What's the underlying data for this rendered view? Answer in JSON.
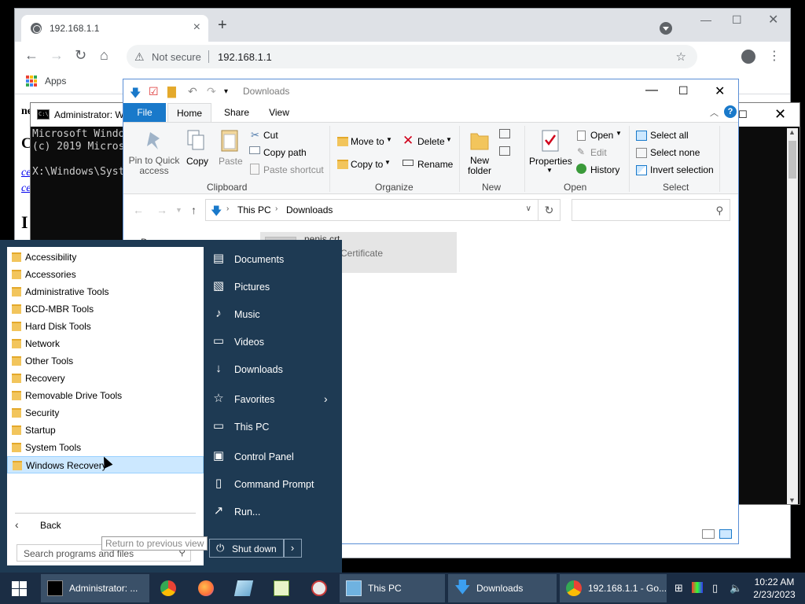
{
  "browser": {
    "tab_title": "192.168.1.1",
    "security_label": "Not secure",
    "url": "192.168.1.1",
    "bookmarks": {
      "apps_label": "Apps"
    },
    "page": {
      "line1": "ne",
      "line2": "C",
      "link1": "ce",
      "link2": "ce",
      "line5": "I"
    }
  },
  "cmd": {
    "title": "Administrator: W",
    "lines": [
      "Microsoft Windo",
      "(c) 2019 Micros",
      "",
      "X:\\Windows\\Syst"
    ]
  },
  "explorer": {
    "title": "Downloads",
    "tabs": {
      "file": "File",
      "home": "Home",
      "share": "Share",
      "view": "View"
    },
    "clipboard": {
      "pin": "Pin to Quick\naccess",
      "copy": "Copy",
      "paste": "Paste",
      "cut": "Cut",
      "copy_path": "Copy path",
      "paste_shortcut": "Paste shortcut",
      "label": "Clipboard"
    },
    "organize": {
      "move_to": "Move to",
      "copy_to": "Copy to",
      "delete": "Delete",
      "rename": "Rename",
      "label": "Organize"
    },
    "new": {
      "new_folder": "New\nfolder",
      "label": "New"
    },
    "open": {
      "properties": "Properties",
      "open": "Open",
      "edit": "Edit",
      "history": "History",
      "label": "Open"
    },
    "select": {
      "select_all": "Select all",
      "select_none": "Select none",
      "invert_selection": "Invert selection",
      "label": "Select"
    },
    "address": {
      "crumb1": "This PC",
      "crumb2": "Downloads"
    },
    "file": {
      "name": "nenis.crt",
      "type": "Certificate"
    },
    "nav_left": "D"
  },
  "start_menu": {
    "programs": [
      "Accessibility",
      "Accessories",
      "Administrative Tools",
      "BCD-MBR Tools",
      "Hard Disk Tools",
      "Network",
      "Other Tools",
      "Recovery",
      "Removable Drive Tools",
      "Security",
      "Startup",
      "System Tools",
      "Windows Recovery"
    ],
    "selected_program": "Windows Recovery",
    "back_label": "Back",
    "tooltip": "Return to previous view",
    "search_placeholder": "Search programs and files",
    "places": {
      "documents": "Documents",
      "pictures": "Pictures",
      "music": "Music",
      "videos": "Videos",
      "downloads": "Downloads",
      "favorites": "Favorites",
      "this_pc": "This PC",
      "control_panel": "Control Panel",
      "command_prompt": "Command Prompt",
      "run": "Run..."
    },
    "shutdown_label": "Shut down"
  },
  "taskbar": {
    "items": {
      "cmd": "Administrator: ...",
      "this_pc": "This PC",
      "downloads": "Downloads",
      "chrome": "192.168.1.1 - Go..."
    },
    "clock": {
      "time": "10:22 AM",
      "date": "2/23/2023"
    }
  },
  "colors": {
    "start_menu_bg": "#1e3a53",
    "taskbar_bg": "#1b2d44",
    "explorer_accent": "#1979ca",
    "selection_bg": "#cce8ff"
  }
}
